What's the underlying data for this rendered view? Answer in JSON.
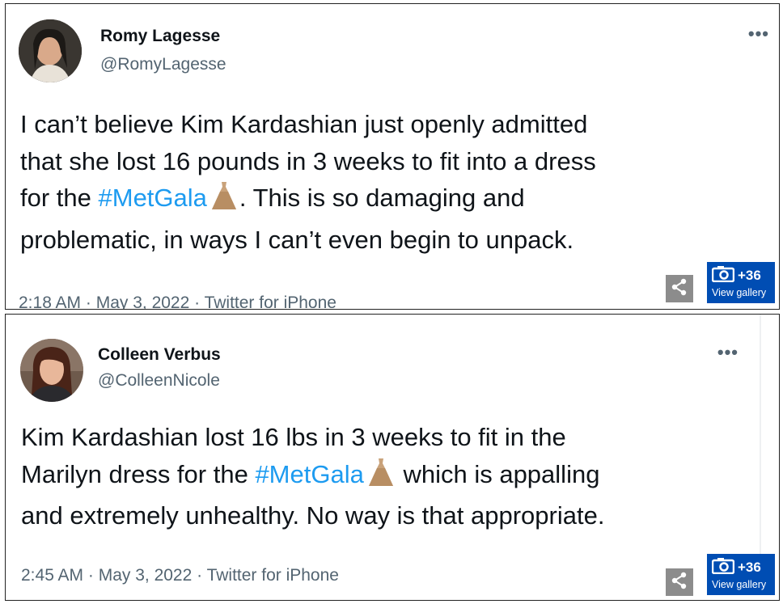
{
  "tweets": [
    {
      "author_name": "Romy Lagesse",
      "author_handle": "@RomyLagesse",
      "more_label": "•••",
      "text_lines": [
        {
          "before": "I can’t believe Kim Kardashian just openly admitted",
          "hashtag": "",
          "after": ""
        },
        {
          "before": "that she lost 16 pounds in 3 weeks to fit into a dress",
          "hashtag": "",
          "after": ""
        },
        {
          "before": "for the ",
          "hashtag": "#MetGala",
          "after": ". This is so damaging and"
        },
        {
          "before": "problematic, in ways I can’t even begin to unpack.",
          "hashtag": "",
          "after": ""
        }
      ],
      "meta": "2:18 AM · May 3, 2022 · Twitter for iPhone",
      "gallery_count": "+36",
      "gallery_label": "View gallery"
    },
    {
      "author_name": "Colleen Verbus",
      "author_handle": "@ColleenNicole",
      "more_label": "•••",
      "text_lines": [
        {
          "before": "Kim Kardashian lost 16 lbs in 3 weeks to fit in the",
          "hashtag": "",
          "after": ""
        },
        {
          "before": "Marilyn dress for the ",
          "hashtag": "#MetGala",
          "after": " which is appalling"
        },
        {
          "before": "and extremely unhealthy. No way is that appropriate.",
          "hashtag": "",
          "after": ""
        }
      ],
      "meta": "2:45 AM · May 3, 2022 · Twitter for iPhone",
      "gallery_count": "+36",
      "gallery_label": "View gallery"
    }
  ],
  "icons": {
    "emoji": "dress-icon",
    "share": "share-icon",
    "gallery": "camera-icon",
    "more": "more-options-icon"
  },
  "colors": {
    "hashtag": "#1d9bf0",
    "handle": "#536471",
    "gallery_bg": "#004db3",
    "share_bg": "#8c8c8c"
  }
}
